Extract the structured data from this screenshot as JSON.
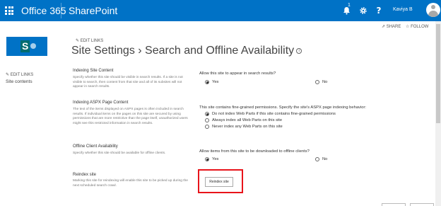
{
  "suitebar": {
    "brand": "Office 365",
    "app": "SharePoint",
    "notification_count": "1",
    "help_glyph": "?",
    "username": "Kaviya B",
    "background": "#0072c6"
  },
  "actions": {
    "share": "SHARE",
    "follow": "FOLLOW"
  },
  "header": {
    "edit_links": "EDIT LINKS",
    "title": "Site Settings › Search and Offline Availability",
    "info_glyph": "i"
  },
  "left_nav": {
    "edit_links": "EDIT LINKS",
    "items": [
      "Site contents"
    ]
  },
  "sections": [
    {
      "heading": "Indexing Site Content",
      "description": "Specify whether this site should be visible in search results. If a site is not visible to search, then content from that site and all of its subsites will not appear in search results.",
      "question": "Allow this site to appear in search results?",
      "options": [
        {
          "label": "Yes",
          "selected": true
        },
        {
          "label": "No",
          "selected": false
        }
      ]
    },
    {
      "heading": "Indexing ASPX Page Content",
      "description": "The text of the items displayed on ASPX pages is often included in search results. If individual items on the pages on this site are secured by using permissions that are more restrictive than the page itself, unauthorized users might see this restricted information in search results.",
      "question": "This site contains fine-grained permissions. Specify the site's ASPX page indexing behavior:",
      "options": [
        {
          "label": "Do not index Web Parts if this site contains fine-grained permissions",
          "selected": true
        },
        {
          "label": "Always index all Web Parts on this site",
          "selected": false
        },
        {
          "label": "Never index any Web Parts on this site",
          "selected": false
        }
      ]
    },
    {
      "heading": "Offline Client Availability",
      "description": "Specify whether this site should be available for offline clients.",
      "question": "Allow items from this site to be downloaded to offline clients?",
      "options": [
        {
          "label": "Yes",
          "selected": true
        },
        {
          "label": "No",
          "selected": false
        }
      ]
    },
    {
      "heading": "Reindex site",
      "description": "Marking this site for reindexing will enable this site to be picked up during the next scheduled search crawl.",
      "button_label": "Reindex site"
    }
  ],
  "highlight_color": "#e8141a"
}
